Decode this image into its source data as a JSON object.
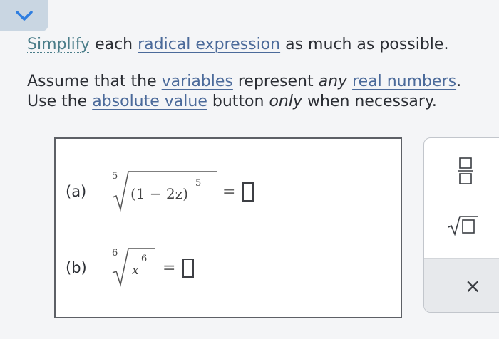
{
  "prompt": {
    "line1": {
      "link1": "Simplify",
      "mid": " each ",
      "link2": "radical expression",
      "end": " as much as possible."
    },
    "line2": {
      "start": "Assume that the ",
      "link1": "variables",
      "mid1": " represent ",
      "em": "any",
      "space": " ",
      "link2": "real numbers",
      "end": "."
    },
    "line3": {
      "start": "Use the ",
      "link1": "absolute value",
      "mid": " button ",
      "em": "only",
      "end": " when necessary."
    }
  },
  "parts": [
    {
      "label": "(a)",
      "index": "5",
      "radicand": "(1 − 2z)",
      "exponent": "5",
      "equals": "="
    },
    {
      "label": "(b)",
      "index": "6",
      "radicand": "x",
      "exponent": "6",
      "equals": "="
    }
  ],
  "toolbox": {
    "clear_label": "×"
  },
  "colors": {
    "link_green": "#4a7d89",
    "link_blue": "#4b6a9a",
    "tab": "#c9d6e2",
    "chevron": "#2f7ee0"
  }
}
